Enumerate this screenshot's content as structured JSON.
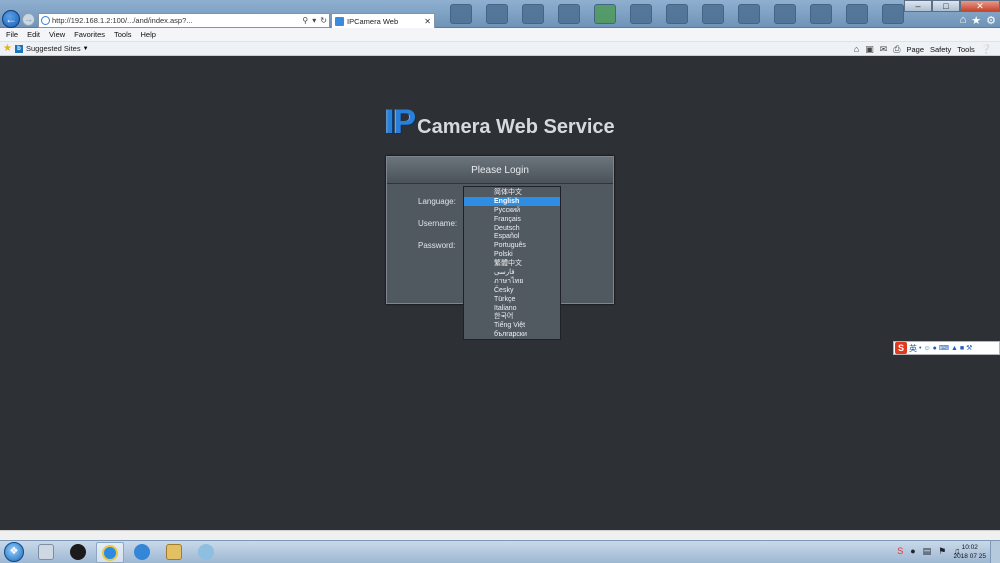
{
  "browser": {
    "address": "http://192.168.1.2:100/.../and/index.asp?...",
    "tab_title": "IPCamera Web",
    "menu": [
      "File",
      "Edit",
      "View",
      "Favorites",
      "Tools",
      "Help"
    ],
    "favorites": {
      "suggested_label": "Suggested Sites"
    },
    "commands": {
      "page": "Page",
      "safety": "Safety",
      "tools": "Tools"
    }
  },
  "page": {
    "logo_ip": "IP",
    "logo_rest": "Camera Web Service",
    "login_title": "Please Login",
    "labels": {
      "language": "Language:",
      "username": "Username:",
      "password": "Password:"
    },
    "languages": [
      "简体中文",
      "English",
      "Русский",
      "Français",
      "Deutsch",
      "Español",
      "Português",
      "Polski",
      "繁體中文",
      "فارسی",
      "ภาษาไทย",
      "Česky",
      "Türkçe",
      "Italiano",
      "한국어",
      "Tiếng Việt",
      "български"
    ],
    "selected_language": "English"
  },
  "ime": {
    "logo": "S",
    "lang": "英"
  },
  "taskbar": {
    "time": "10:02",
    "date": "2018 07 25"
  },
  "colors": {
    "page_bg": "#2d3034",
    "panel_bg": "#515960",
    "accent": "#2d8ee3",
    "logo_blue": "#2a7fd8"
  }
}
